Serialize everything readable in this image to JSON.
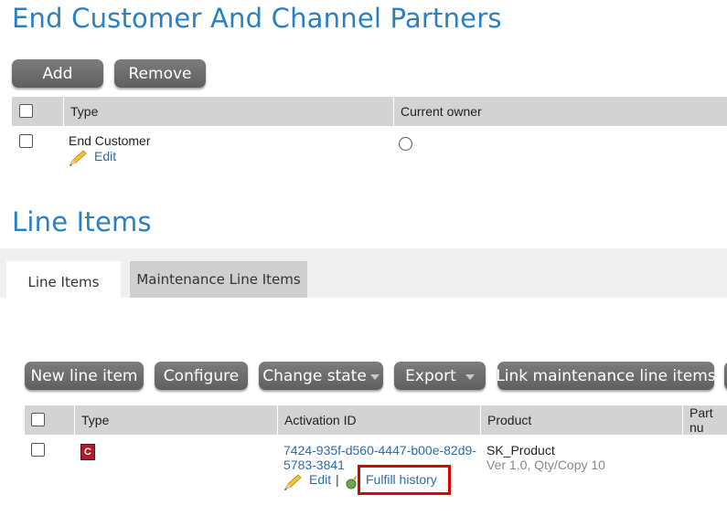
{
  "ecp": {
    "title": "End Customer And Channel Partners",
    "add_label": "Add",
    "remove_label": "Remove",
    "columns": {
      "type": "Type",
      "current_owner": "Current owner"
    },
    "row": {
      "type": "End Customer",
      "edit": "Edit"
    }
  },
  "line_items": {
    "title": "Line Items",
    "tabs": [
      {
        "label": "Line Items"
      },
      {
        "label": "Maintenance Line Items"
      }
    ],
    "toolbar": {
      "new_line_item": "New line item",
      "configure": "Configure",
      "change_state": "Change state",
      "export": "Export",
      "link_maintenance": "Link maintenance line items"
    },
    "columns": {
      "type": "Type",
      "activation_id": "Activation ID",
      "product": "Product",
      "part_number": "Part nu"
    },
    "row": {
      "type_badge": "C",
      "activation_id_line1": "7424-935f-d560-4447-b00e-82d9-",
      "activation_id_line2": "5783-3841",
      "edit": "Edit",
      "separator": "|",
      "fulfill_history": "Fulfill history",
      "product_name": "SK_Product",
      "product_version": "Ver 1.0, Qty/Copy 10"
    }
  },
  "colors": {
    "accent": "#2a7fc1",
    "highlight_box": "#e00000",
    "badge": "#b01a2e"
  }
}
